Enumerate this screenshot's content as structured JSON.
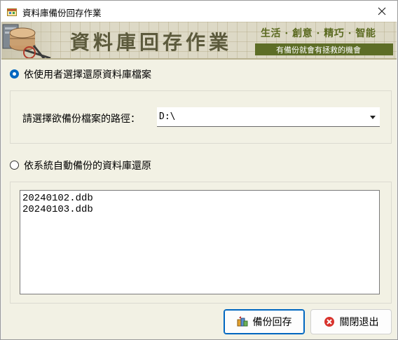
{
  "window": {
    "title": "資料庫備份回存作業"
  },
  "banner": {
    "title": "資料庫回存作業",
    "slogan": "生活 · 創意 · 精巧 · 智能",
    "tagline": "有備份就會有拯救的機會"
  },
  "option_manual": {
    "label": "依使用者選擇還原資料庫檔案",
    "checked": true,
    "path_label": "請選擇欲備份檔案的路徑：",
    "path_value": "D:\\"
  },
  "option_auto": {
    "label": "依系統自動備份的資料庫還原",
    "checked": false,
    "files": [
      "20240102.ddb",
      "20240103.ddb"
    ]
  },
  "buttons": {
    "restore": "備份回存",
    "close": "關閉退出"
  },
  "colors": {
    "accent": "#0067c0",
    "banner_bg": "#ddd9c6",
    "tagline_bg": "#5d6d26",
    "close_icon_red": "#d8322c"
  },
  "icons": {
    "app": "database-window-icon",
    "close": "close-icon",
    "restore": "database-restore-icon",
    "exit": "cancel-circle-icon"
  }
}
